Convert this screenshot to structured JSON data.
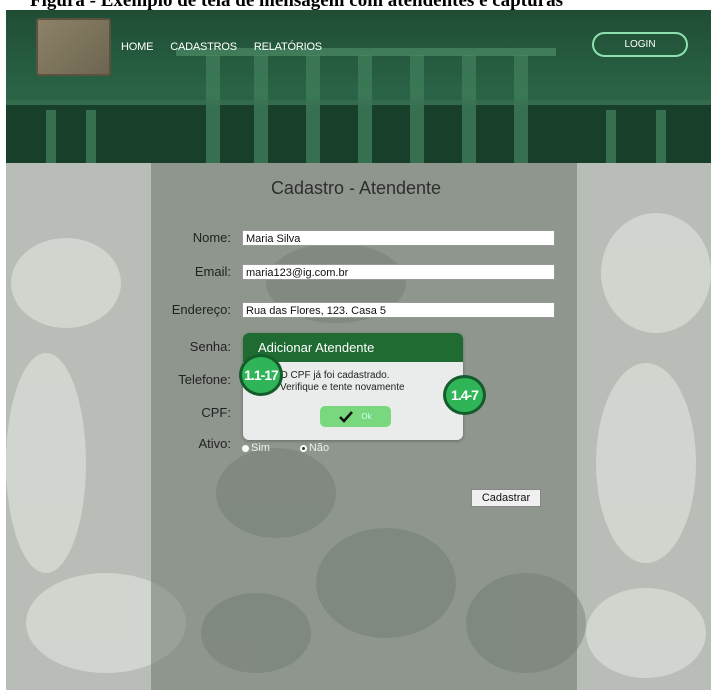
{
  "caption": "Figura - Exemplo de tela de mensagem com atendentes e capturas",
  "header": {
    "nav": [
      "HOME",
      "CADASTROS",
      "RELATÓRIOS"
    ],
    "login_label": "LOGIN"
  },
  "form": {
    "title": "Cadastro - Atendente",
    "labels": {
      "nome": "Nome:",
      "email": "Email:",
      "endereco": "Endereço:",
      "senha": "Senha:",
      "telefone": "Telefone:",
      "cpf": "CPF:",
      "ativo": "Ativo:"
    },
    "values": {
      "nome": "Maria Silva",
      "email": "maria123@ig.com.br",
      "endereco": "Rua das Flores, 123. Casa 5"
    },
    "ativo_options": [
      "Sim",
      "Não"
    ],
    "ativo_selected": "Não",
    "submit_label": "Cadastrar"
  },
  "dialog": {
    "title": "Adicionar Atendente",
    "message_line1": "O CPF já foi cadastrado.",
    "message_line2": "Verifique e tente novamente",
    "ok_label": "Ok"
  },
  "badges": [
    "1.1-17",
    "1.4-7"
  ],
  "colors": {
    "header_green": "#2a6446",
    "dialog_header": "#1f6b32",
    "ok_button": "#79d87e",
    "badge_fill": "#2fb457",
    "login_border": "#8fe0b0"
  }
}
